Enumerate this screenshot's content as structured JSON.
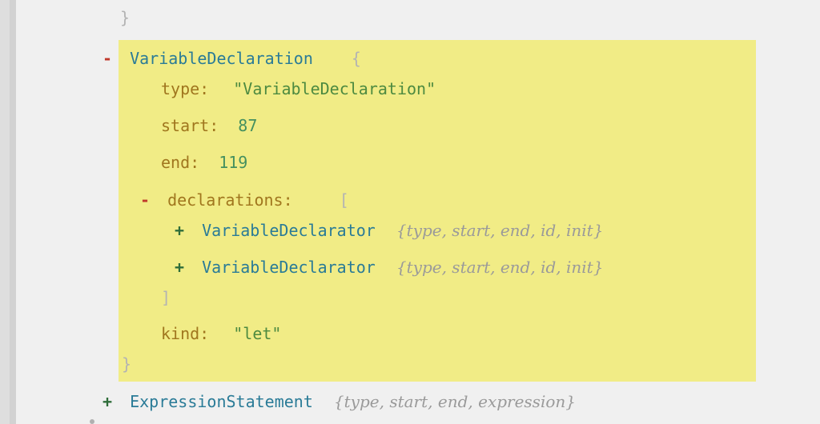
{
  "tree": {
    "top_bracket": "}",
    "variable_declaration": {
      "toggle": "-",
      "name": "VariableDeclaration",
      "open_bracket": "{",
      "type_key": "type:",
      "type_value": "\"VariableDeclaration\"",
      "start_key": "start:",
      "start_value": "87",
      "end_key": "end:",
      "end_value": "119",
      "declarations": {
        "toggle": "-",
        "key": "declarations:",
        "open_bracket": "[",
        "items": [
          {
            "toggle": "+",
            "name": "VariableDeclarator",
            "summary": "{type, start, end, id, init}"
          },
          {
            "toggle": "+",
            "name": "VariableDeclarator",
            "summary": "{type, start, end, id, init}"
          }
        ],
        "close_bracket": "]"
      },
      "kind_key": "kind:",
      "kind_value": "\"let\"",
      "close_bracket": "}"
    },
    "expression_statement": {
      "toggle": "+",
      "name": "ExpressionStatement",
      "summary": "{type, start, end, expression}"
    }
  },
  "colors": {
    "highlight": "#f1ec86",
    "node_name": "#2a7b97",
    "property_key": "#a0761e",
    "number": "#45905f",
    "string": "#4d8a40",
    "collapse_toggle": "#c0392b",
    "expand_toggle": "#2f6d3a"
  }
}
